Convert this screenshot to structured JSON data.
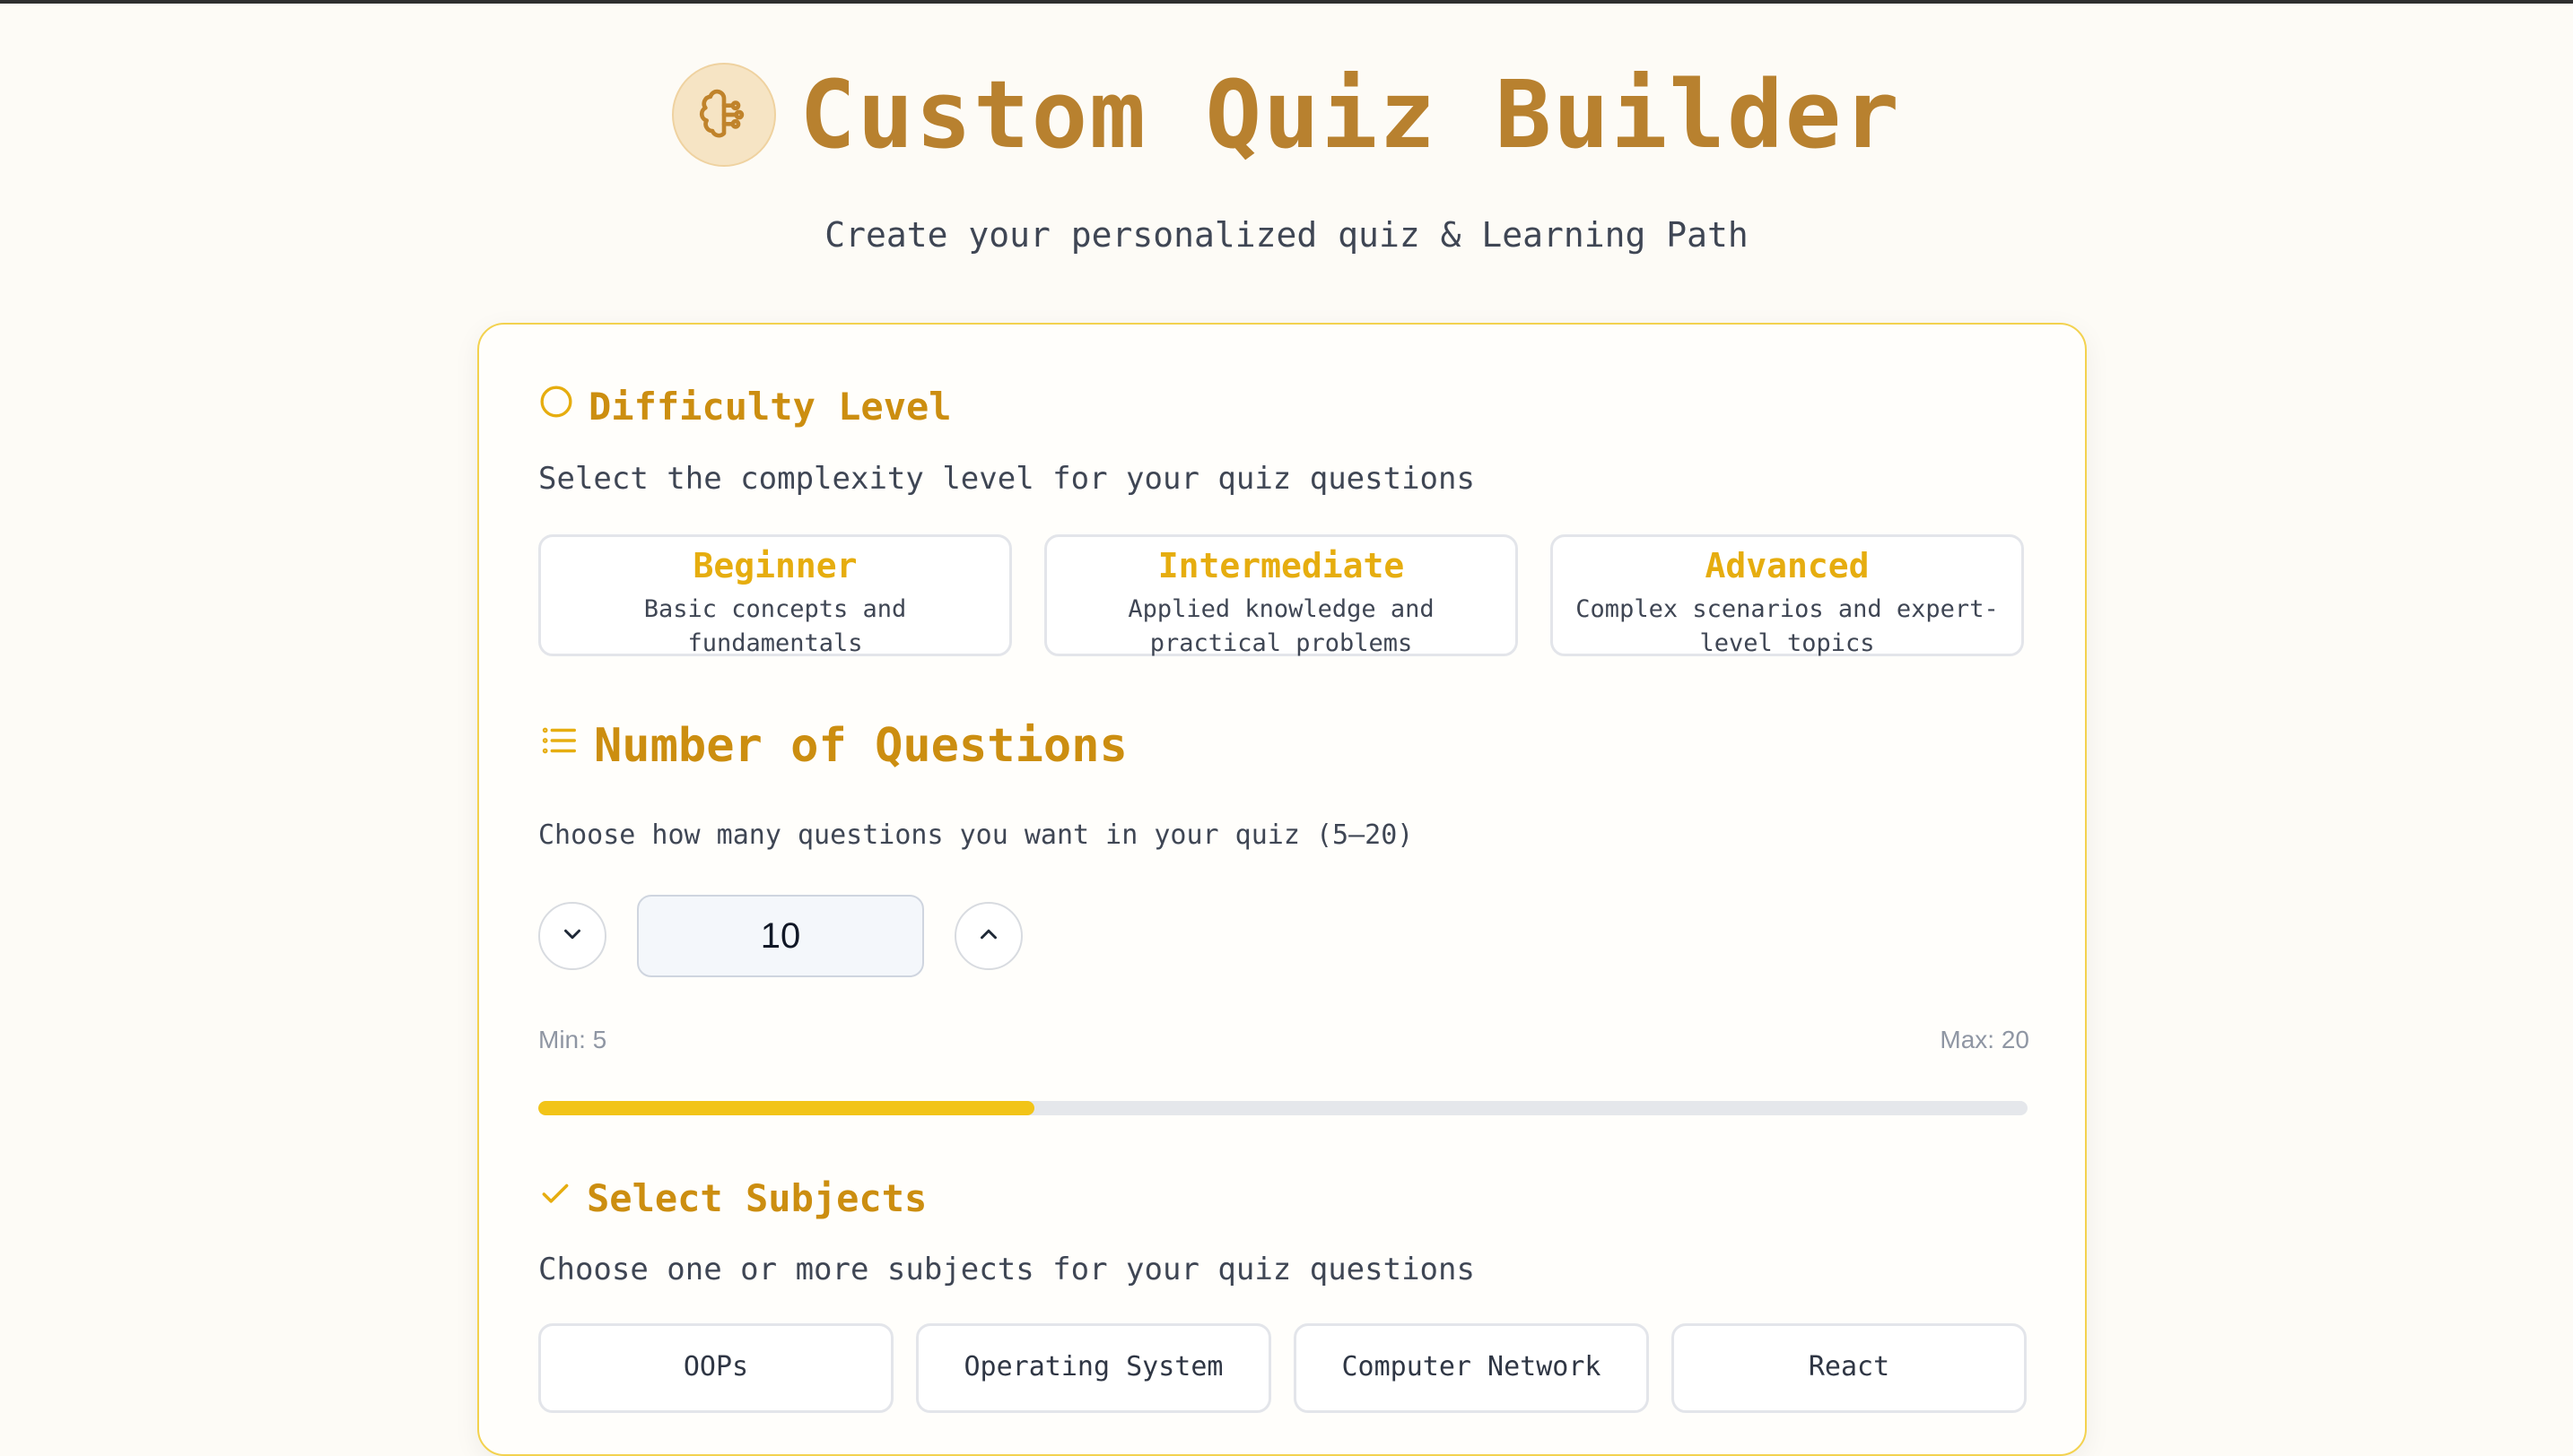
{
  "app": {
    "title": "Custom Quiz Builder",
    "subtitle": "Create your personalized quiz & Learning Path",
    "accent": "#b8812f"
  },
  "difficulty": {
    "title": "Difficulty Level",
    "description": "Select the complexity level for your quiz questions",
    "options": [
      {
        "name": "Beginner",
        "description": "Basic concepts and fundamentals"
      },
      {
        "name": "Intermediate",
        "description": "Applied knowledge and practical problems"
      },
      {
        "name": "Advanced",
        "description": "Complex scenarios and expert-level topics"
      }
    ]
  },
  "questions": {
    "title": "Number of Questions",
    "description": "Choose how many questions you want in your quiz (5–20)",
    "value": "10",
    "min_label": "Min: 5",
    "max_label": "Max: 20",
    "min": 5,
    "max": 20,
    "progress_fraction": 0.333
  },
  "subjects": {
    "title": "Select Subjects",
    "description": "Choose one or more subjects for your quiz questions",
    "items": [
      "OOPs",
      "Operating System",
      "Computer Network",
      "React"
    ]
  },
  "icons": {
    "logo": "brain-icon",
    "difficulty": "circle-icon",
    "questions": "list-icon",
    "subjects": "check-icon",
    "decrement": "chevron-down-icon",
    "increment": "chevron-up-icon"
  },
  "colors": {
    "section_title": "#cc8e10",
    "option_name": "#e6ad0f",
    "progress_fill": "#f2c418",
    "card_border": "#f3d24f"
  }
}
